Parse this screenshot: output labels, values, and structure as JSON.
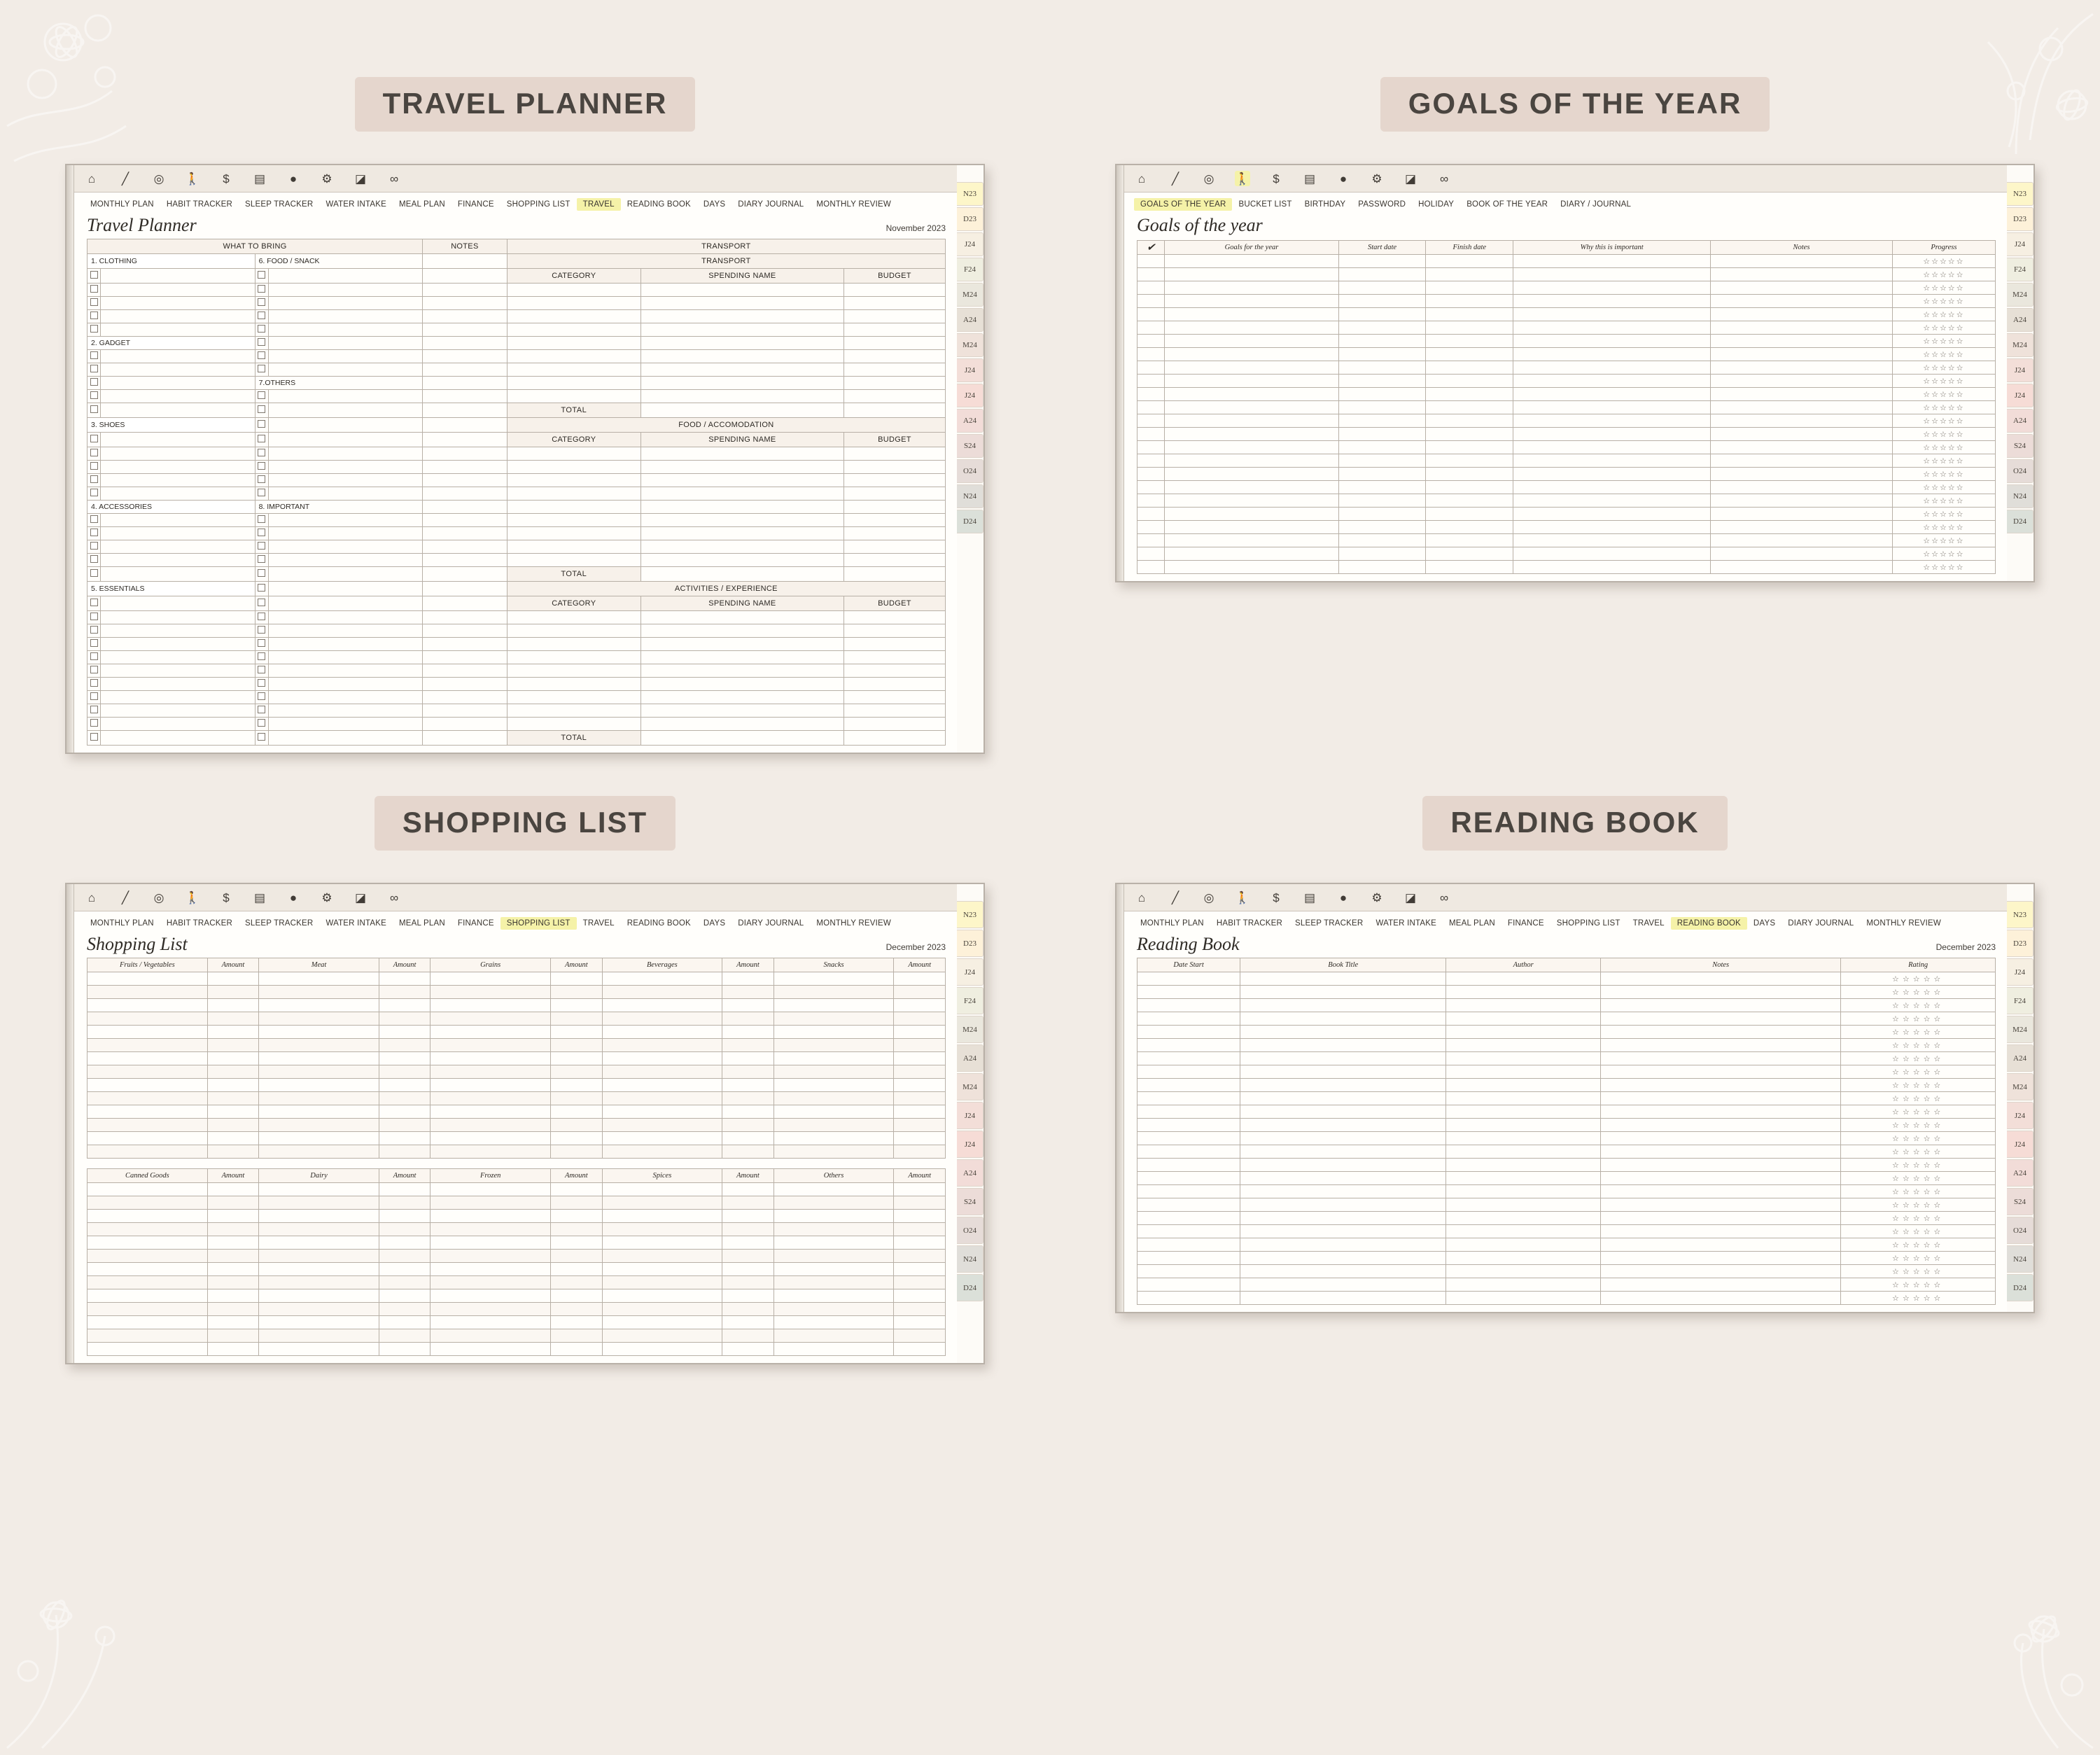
{
  "sections": {
    "travel": "TRAVEL PLANNER",
    "goals": "GOALS OF THE YEAR",
    "shopping": "SHOPPING LIST",
    "reading": "READING BOOK"
  },
  "toolbar_icons": [
    "home-icon",
    "pen-icon",
    "eraser-icon",
    "walk-icon",
    "dollar-icon",
    "note-icon",
    "circle-icon",
    "gear-icon",
    "bookmark-icon",
    "link-icon"
  ],
  "nav_main": [
    "MONTHLY PLAN",
    "HABIT TRACKER",
    "SLEEP TRACKER",
    "WATER INTAKE",
    "MEAL PLAN",
    "FINANCE",
    "SHOPPING LIST",
    "TRAVEL",
    "READING BOOK",
    "DAYS",
    "DIARY JOURNAL",
    "MONTHLY REVIEW"
  ],
  "nav_goals": [
    "GOALS OF THE YEAR",
    "BUCKET LIST",
    "BIRTHDAY",
    "PASSWORD",
    "HOLIDAY",
    "BOOK OF THE YEAR",
    "DIARY / JOURNAL"
  ],
  "month_tabs": [
    "N23",
    "D23",
    "J24",
    "F24",
    "M24",
    "A24",
    "M24",
    "J24",
    "J24",
    "A24",
    "S24",
    "O24",
    "N24",
    "D24"
  ],
  "travel": {
    "title": "Travel Planner",
    "date": "November 2023",
    "active_nav": "TRAVEL",
    "headers": {
      "bring": "WHAT TO BRING",
      "notes": "NOTES",
      "transport": "TRANSPORT"
    },
    "sub_headers": {
      "category": "CATEGORY",
      "spending": "SPENDING NAME",
      "budget": "BUDGET"
    },
    "left_groups": [
      "1. CLOTHING",
      "2. GADGET",
      "3. SHOES",
      "4. ACCESSORIES",
      "5. ESSENTIALS"
    ],
    "right_groups": [
      "6. FOOD / SNACK",
      "7.OTHERS",
      "8. IMPORTANT"
    ],
    "blocks": [
      "TRANSPORT",
      "FOOD / ACCOMODATION",
      "ACTIVITIES / EXPERIENCE"
    ],
    "total": "TOTAL"
  },
  "goals": {
    "title": "Goals of the year",
    "active_nav": "GOALS OF THE YEAR",
    "check_icon": "✔",
    "columns": [
      "Goals for the year",
      "Start date",
      "Finish date",
      "Why this is important",
      "Notes",
      "Progress"
    ],
    "rows": 24,
    "star": "☆",
    "stars_per_row": 5
  },
  "shopping": {
    "title": "Shopping List",
    "date": "December 2023",
    "active_nav": "SHOPPING LIST",
    "top_columns": [
      "Fruits / Vegetables",
      "Amount",
      "Meat",
      "Amount",
      "Grains",
      "Amount",
      "Beverages",
      "Amount",
      "Snacks",
      "Amount"
    ],
    "bottom_columns": [
      "Canned Goods",
      "Amount",
      "Dairy",
      "Amount",
      "Frozen",
      "Amount",
      "Spices",
      "Amount",
      "Others",
      "Amount"
    ],
    "top_rows": 14,
    "bottom_rows": 13
  },
  "reading": {
    "title": "Reading Book",
    "date": "December 2023",
    "active_nav": "READING BOOK",
    "columns": [
      "Date Start",
      "Book Title",
      "Author",
      "Notes",
      "Rating"
    ],
    "rows": 25,
    "star": "☆",
    "stars_per_row": 5
  }
}
